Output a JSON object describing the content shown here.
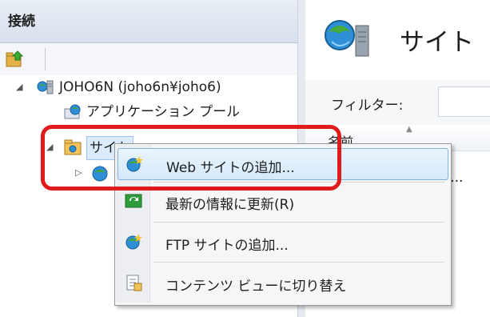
{
  "left_pane": {
    "title": "接続",
    "tree": [
      {
        "label": "JOHO6N (joho6n¥joho6)",
        "icon": "server-icon",
        "expanded": true
      },
      {
        "label": "アプリケーション プール",
        "icon": "app-pool-icon"
      },
      {
        "label": "サイト",
        "icon": "sites-folder-icon",
        "expanded": true,
        "selected": true
      },
      {
        "label": "",
        "icon": "website-globe-icon",
        "expanded": false
      }
    ]
  },
  "right_pane": {
    "title": "サイト",
    "filter_label": "フィルター:",
    "column_name": "名前",
    "row_partial": "b ..."
  },
  "context_menu": {
    "items": [
      {
        "label": "Web サイトの追加...",
        "icon": "add-website-icon",
        "highlighted": true
      },
      {
        "label": "最新の情報に更新(R)",
        "icon": "refresh-icon"
      },
      {
        "label": "FTP サイトの追加...",
        "icon": "add-ftp-site-icon"
      },
      {
        "label": "コンテンツ ビューに切り替え",
        "icon": "content-view-icon"
      }
    ]
  },
  "colors": {
    "annotation": "#e01b1b",
    "menu_highlight_border": "#7fb2e6",
    "header_bg": "#e9eef5"
  }
}
